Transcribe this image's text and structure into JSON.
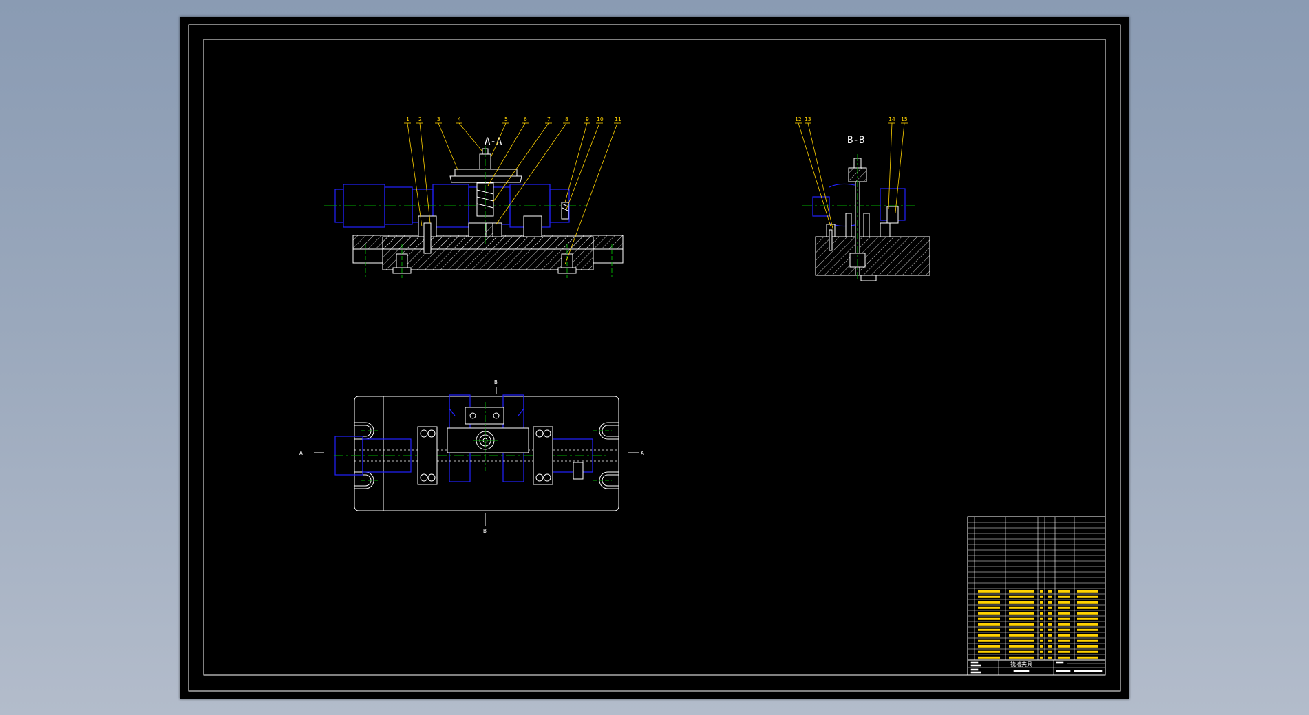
{
  "drawing": {
    "section_aa_label": "A-A",
    "section_bb_label": "B-B",
    "cut_a_letter": "A",
    "cut_b_letter": "B",
    "callouts_aa": [
      "1",
      "2",
      "3",
      "4",
      "5",
      "6",
      "7",
      "8",
      "9",
      "10",
      "11"
    ],
    "callouts_bb": [
      "12",
      "13",
      "14",
      "15"
    ]
  },
  "title_block": {
    "main_title": "铣槽夹具",
    "colors": {
      "parts_text": "#ffd200",
      "table_lines": "#ffffff",
      "border": "#ffffff"
    }
  }
}
